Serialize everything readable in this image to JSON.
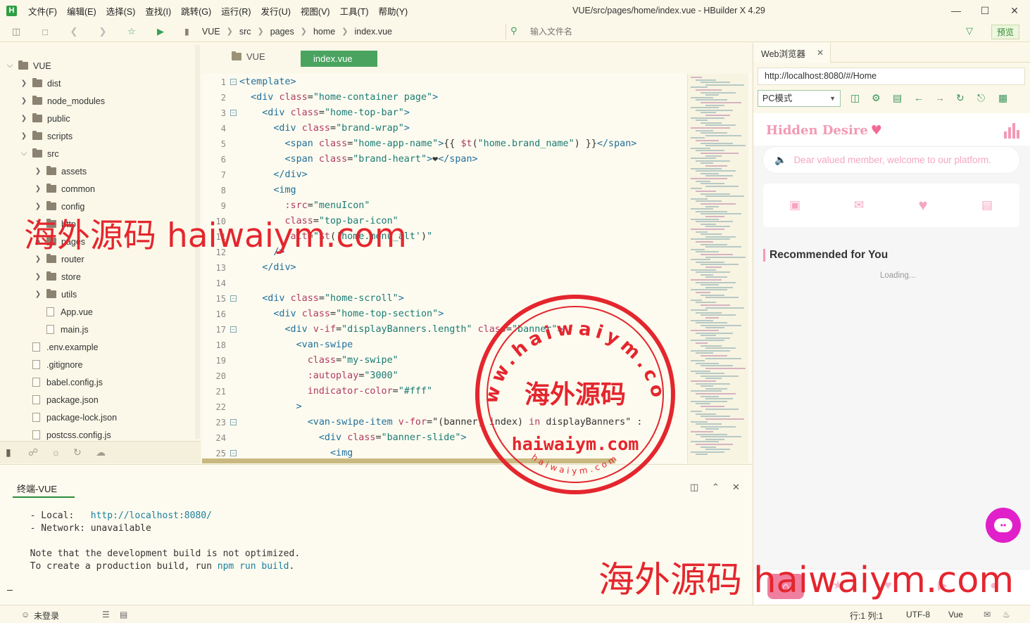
{
  "window": {
    "title": "VUE/src/pages/home/index.vue - HBuilder X 4.29",
    "app_logo": "H",
    "menus": [
      "文件(F)",
      "编辑(E)",
      "选择(S)",
      "查找(I)",
      "跳转(G)",
      "运行(R)",
      "发行(U)",
      "视图(V)",
      "工具(T)",
      "帮助(Y)"
    ]
  },
  "toolbar": {
    "breadcrumbs": [
      "VUE",
      "src",
      "pages",
      "home",
      "index.vue"
    ],
    "file_search_placeholder": "输入文件名",
    "preview_label": "预览"
  },
  "file_tree": [
    {
      "name": "VUE",
      "type": "folder",
      "level": 0,
      "expanded": true
    },
    {
      "name": "dist",
      "type": "folder",
      "level": 1,
      "expanded": false
    },
    {
      "name": "node_modules",
      "type": "folder",
      "level": 1,
      "expanded": false
    },
    {
      "name": "public",
      "type": "folder",
      "level": 1,
      "expanded": false
    },
    {
      "name": "scripts",
      "type": "folder",
      "level": 1,
      "expanded": false
    },
    {
      "name": "src",
      "type": "folder",
      "level": 1,
      "expanded": true
    },
    {
      "name": "assets",
      "type": "folder",
      "level": 2,
      "expanded": false
    },
    {
      "name": "common",
      "type": "folder",
      "level": 2,
      "expanded": false
    },
    {
      "name": "config",
      "type": "folder",
      "level": 2,
      "expanded": false
    },
    {
      "name": "http",
      "type": "folder",
      "level": 2,
      "expanded": false
    },
    {
      "name": "pages",
      "type": "folder",
      "level": 2,
      "expanded": false
    },
    {
      "name": "router",
      "type": "folder",
      "level": 2,
      "expanded": false
    },
    {
      "name": "store",
      "type": "folder",
      "level": 2,
      "expanded": false
    },
    {
      "name": "utils",
      "type": "folder",
      "level": 2,
      "expanded": false
    },
    {
      "name": "App.vue",
      "type": "file",
      "level": 2
    },
    {
      "name": "main.js",
      "type": "file",
      "level": 2
    },
    {
      "name": ".env.example",
      "type": "file",
      "level": 1
    },
    {
      "name": ".gitignore",
      "type": "file",
      "level": 1
    },
    {
      "name": "babel.config.js",
      "type": "file",
      "level": 1
    },
    {
      "name": "package.json",
      "type": "file",
      "level": 1
    },
    {
      "name": "package-lock.json",
      "type": "file",
      "level": 1
    },
    {
      "name": "postcss.config.js",
      "type": "file",
      "level": 1
    }
  ],
  "editor": {
    "project_tab": "VUE",
    "active_tab": "index.vue",
    "lines": [
      {
        "n": "1",
        "fold": true,
        "segs": [
          [
            "tag",
            "<template>"
          ]
        ]
      },
      {
        "n": "2",
        "fold": false,
        "segs": [
          [
            "tag",
            "  <div "
          ],
          [
            "att",
            "class"
          ],
          [
            "txt",
            "="
          ],
          [
            "str",
            "\"home-container page\""
          ],
          [
            "tag",
            ">"
          ]
        ]
      },
      {
        "n": "3",
        "fold": true,
        "segs": [
          [
            "tag",
            "    <div "
          ],
          [
            "att",
            "class"
          ],
          [
            "txt",
            "="
          ],
          [
            "str",
            "\"home-top-bar\""
          ],
          [
            "tag",
            ">"
          ]
        ]
      },
      {
        "n": "4",
        "fold": false,
        "segs": [
          [
            "tag",
            "      <div "
          ],
          [
            "att",
            "class"
          ],
          [
            "txt",
            "="
          ],
          [
            "str",
            "\"brand-wrap\""
          ],
          [
            "tag",
            ">"
          ]
        ]
      },
      {
        "n": "5",
        "fold": false,
        "segs": [
          [
            "tag",
            "        <span "
          ],
          [
            "att",
            "class"
          ],
          [
            "txt",
            "="
          ],
          [
            "str",
            "\"home-app-name\""
          ],
          [
            "tag",
            ">"
          ],
          [
            "txt",
            "{{ "
          ],
          [
            "att",
            "$t"
          ],
          [
            "txt",
            "("
          ],
          [
            "str",
            "\"home.brand_name\""
          ],
          [
            "txt",
            ") }}"
          ],
          [
            "tag",
            "</span>"
          ]
        ]
      },
      {
        "n": "6",
        "fold": false,
        "segs": [
          [
            "tag",
            "        <span "
          ],
          [
            "att",
            "class"
          ],
          [
            "txt",
            "="
          ],
          [
            "str",
            "\"brand-heart\""
          ],
          [
            "tag",
            ">"
          ],
          [
            "txt",
            "❤"
          ],
          [
            "tag",
            "</span>"
          ]
        ]
      },
      {
        "n": "7",
        "fold": false,
        "segs": [
          [
            "tag",
            "      </div>"
          ]
        ]
      },
      {
        "n": "8",
        "fold": false,
        "segs": [
          [
            "tag",
            "      <img"
          ]
        ]
      },
      {
        "n": "9",
        "fold": false,
        "segs": [
          [
            "att",
            "        :src"
          ],
          [
            "txt",
            "="
          ],
          [
            "str",
            "\"menuIcon\""
          ]
        ]
      },
      {
        "n": "10",
        "fold": false,
        "segs": [
          [
            "att",
            "        class"
          ],
          [
            "txt",
            "="
          ],
          [
            "str",
            "\"top-bar-icon\""
          ]
        ]
      },
      {
        "n": "11",
        "fold": false,
        "segs": [
          [
            "att",
            "        :alt"
          ],
          [
            "txt",
            "="
          ],
          [
            "str",
            "\""
          ],
          [
            "att",
            "$t"
          ],
          [
            "txt",
            "("
          ],
          [
            "str",
            "'home.menu_alt'"
          ],
          [
            "txt",
            ")"
          ],
          [
            "str",
            "\""
          ]
        ]
      },
      {
        "n": "12",
        "fold": false,
        "segs": [
          [
            "tag",
            "      />"
          ]
        ]
      },
      {
        "n": "13",
        "fold": false,
        "segs": [
          [
            "tag",
            "    </div>"
          ]
        ]
      },
      {
        "n": "14",
        "fold": false,
        "segs": []
      },
      {
        "n": "15",
        "fold": true,
        "segs": [
          [
            "tag",
            "    <div "
          ],
          [
            "att",
            "class"
          ],
          [
            "txt",
            "="
          ],
          [
            "str",
            "\"home-scroll\""
          ],
          [
            "tag",
            ">"
          ]
        ]
      },
      {
        "n": "16",
        "fold": false,
        "segs": [
          [
            "tag",
            "      <div "
          ],
          [
            "att",
            "class"
          ],
          [
            "txt",
            "="
          ],
          [
            "str",
            "\"home-top-section\""
          ],
          [
            "tag",
            ">"
          ]
        ]
      },
      {
        "n": "17",
        "fold": true,
        "segs": [
          [
            "tag",
            "        <div "
          ],
          [
            "att",
            "v-if"
          ],
          [
            "txt",
            "="
          ],
          [
            "str",
            "\"displayBanners.length\""
          ],
          [
            "txt",
            " "
          ],
          [
            "att",
            "class"
          ],
          [
            "txt",
            "="
          ],
          [
            "str",
            "\"banner\""
          ],
          [
            "tag",
            ">"
          ]
        ]
      },
      {
        "n": "18",
        "fold": false,
        "segs": [
          [
            "tag",
            "          <van-swipe"
          ]
        ]
      },
      {
        "n": "19",
        "fold": false,
        "segs": [
          [
            "att",
            "            class"
          ],
          [
            "txt",
            "="
          ],
          [
            "str",
            "\"my-swipe\""
          ]
        ]
      },
      {
        "n": "20",
        "fold": false,
        "segs": [
          [
            "att",
            "            :autoplay"
          ],
          [
            "txt",
            "="
          ],
          [
            "str",
            "\"3000\""
          ]
        ]
      },
      {
        "n": "21",
        "fold": false,
        "segs": [
          [
            "att",
            "            indicator-color"
          ],
          [
            "txt",
            "="
          ],
          [
            "str",
            "\"#fff\""
          ]
        ]
      },
      {
        "n": "22",
        "fold": false,
        "segs": [
          [
            "tag",
            "          >"
          ]
        ]
      },
      {
        "n": "23",
        "fold": true,
        "segs": [
          [
            "tag",
            "            <van-swipe-item "
          ],
          [
            "att",
            "v-for"
          ],
          [
            "txt",
            "=\"(banner, index) "
          ],
          [
            "att",
            "in"
          ],
          [
            "txt",
            " displayBanners\" :"
          ]
        ]
      },
      {
        "n": "24",
        "fold": false,
        "segs": [
          [
            "tag",
            "              <div "
          ],
          [
            "att",
            "class"
          ],
          [
            "txt",
            "="
          ],
          [
            "str",
            "\"banner-slide\""
          ],
          [
            "tag",
            ">"
          ]
        ]
      },
      {
        "n": "25",
        "fold": true,
        "segs": [
          [
            "tag",
            "                <img"
          ]
        ]
      }
    ]
  },
  "terminal": {
    "title": "终端-VUE",
    "local_label": "  - Local:   ",
    "local_url": "http://localhost:8080/",
    "network_line": "  - Network: unavailable",
    "note_line": "  Note that the development build is not optimized.",
    "build_prefix": "  To create a production build, run ",
    "build_cmd": "npm run build",
    "build_suffix": "."
  },
  "browser": {
    "tab_label": "Web浏览器",
    "url": "http://localhost:8080/#/Home",
    "mode": "PC模式",
    "app": {
      "brand_name": "Hidden Desire",
      "brand_heart": "♥",
      "notice": "Dear valued member, welcome to our platform.",
      "recommend_title": "Recommended for You",
      "loading": "Loading..."
    }
  },
  "statusbar": {
    "login": "未登录",
    "position": "行:1  列:1",
    "encoding": "UTF-8",
    "language": "Vue"
  },
  "watermark": {
    "banner": "海外源码 haiwaiym.com",
    "stamp_center": "海外源码",
    "stamp_domain": "haiwaiym.com",
    "stamp_ring": "haiwaiym.com",
    "stamp_ring_top": "www.haiwaiym.com",
    "color": "#e4262e"
  }
}
